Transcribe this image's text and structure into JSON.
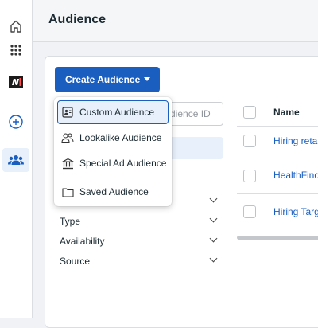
{
  "header": {
    "title": "Audience"
  },
  "rail": {
    "items": [
      {
        "icon": "home-icon"
      },
      {
        "icon": "apps-grid-icon"
      },
      {
        "icon": "brand-logo-icon"
      },
      {
        "icon": "add-circle-icon"
      },
      {
        "icon": "audience-people-icon",
        "active": true
      }
    ]
  },
  "toolbar": {
    "create_label": "Create Audience",
    "search_placeholder": "dience ID"
  },
  "dropdown": {
    "items": [
      {
        "label": "Custom Audience",
        "icon": "custom-audience-icon",
        "selected": true
      },
      {
        "label": "Lookalike Audience",
        "icon": "lookalike-icon"
      },
      {
        "label": "Special Ad Audience",
        "icon": "bank-icon"
      },
      {
        "label": "Saved Audience",
        "icon": "folder-icon"
      }
    ]
  },
  "filters": {
    "items": [
      {
        "label": ""
      },
      {
        "label": "Type"
      },
      {
        "label": "Availability"
      },
      {
        "label": "Source"
      }
    ]
  },
  "table": {
    "header_name": "Name",
    "rows": [
      {
        "name": "Hiring retar"
      },
      {
        "name": "HealthFind"
      },
      {
        "name": "Hiring Targ"
      }
    ]
  },
  "colors": {
    "accent": "#1a5fc0",
    "selected_bg": "#e7f0fb"
  }
}
